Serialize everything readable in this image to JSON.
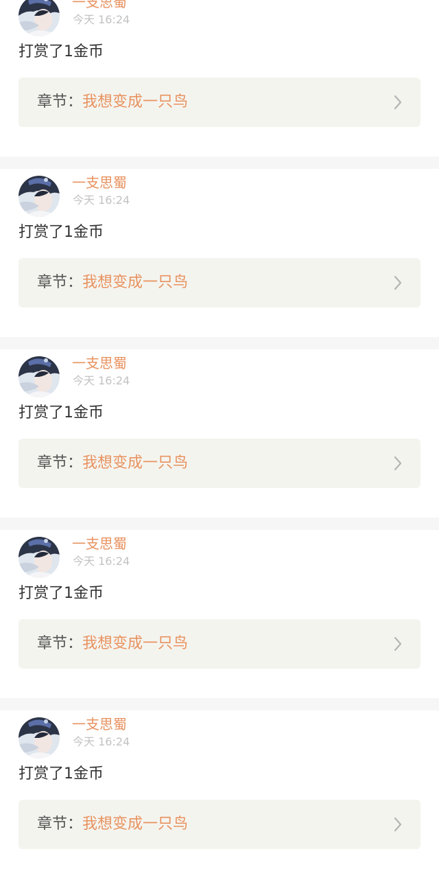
{
  "theme": {
    "accent": "#e8925f",
    "time_color": "#c2c2c2",
    "card_bg": "#f4f4ef",
    "separator": "#f7f6f6"
  },
  "icons": {
    "avatar": "avatar-icon",
    "chevron": "chevron-right-icon"
  },
  "feed": [
    {
      "user": "一支思蜀",
      "time": "今天 16:24",
      "action": "打赏了1金币",
      "chapter_label": "章节：",
      "chapter_title": "我想变成一只鸟"
    },
    {
      "user": "一支思蜀",
      "time": "今天 16:24",
      "action": "打赏了1金币",
      "chapter_label": "章节：",
      "chapter_title": "我想变成一只鸟"
    },
    {
      "user": "一支思蜀",
      "time": "今天 16:24",
      "action": "打赏了1金币",
      "chapter_label": "章节：",
      "chapter_title": "我想变成一只鸟"
    },
    {
      "user": "一支思蜀",
      "time": "今天 16:24",
      "action": "打赏了1金币",
      "chapter_label": "章节：",
      "chapter_title": "我想变成一只鸟"
    },
    {
      "user": "一支思蜀",
      "time": "今天 16:24",
      "action": "打赏了1金币",
      "chapter_label": "章节：",
      "chapter_title": "我想变成一只鸟"
    }
  ]
}
